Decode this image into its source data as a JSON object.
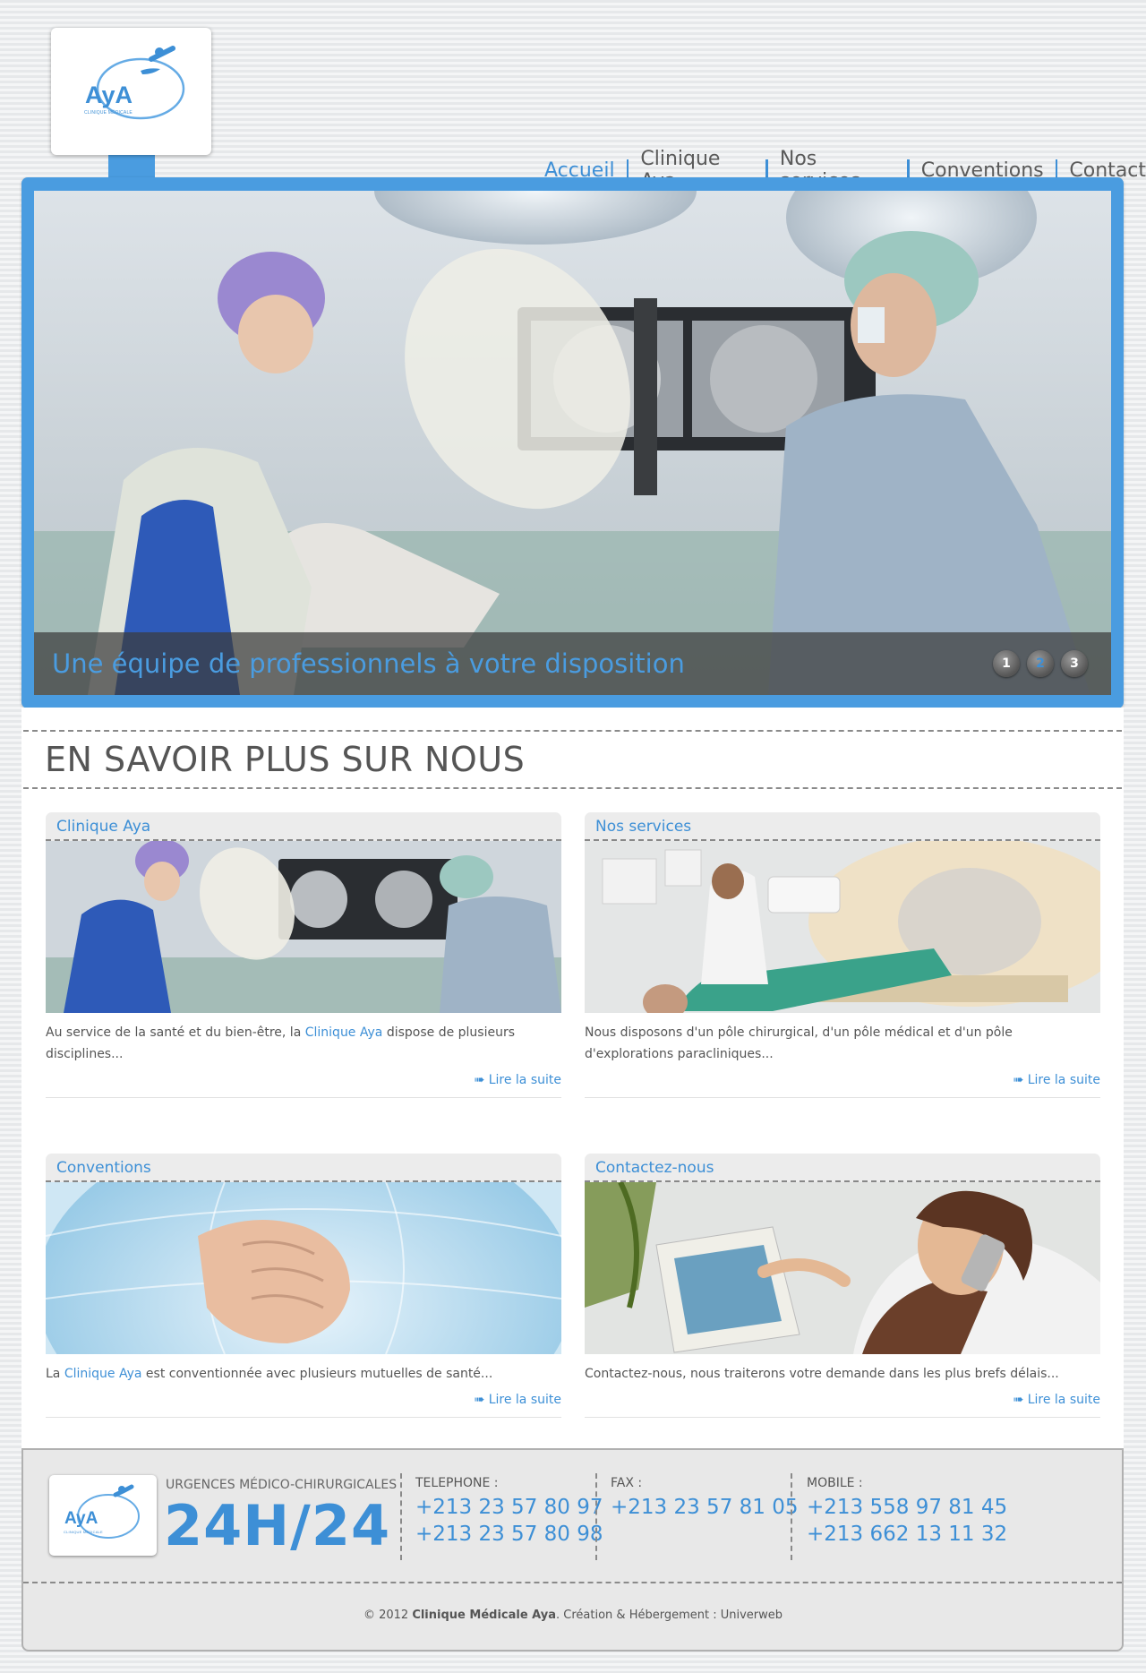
{
  "brand": {
    "logo_text": "AyA",
    "logo_subtext": "CLINIQUE MÉDICALE"
  },
  "nav": {
    "items": [
      {
        "label": "Accueil",
        "active": true
      },
      {
        "label": "Clinique Aya"
      },
      {
        "label": "Nos services"
      },
      {
        "label": "Conventions"
      },
      {
        "label": "Contact"
      }
    ]
  },
  "hero": {
    "caption": "Une équipe de professionnels à votre disposition",
    "dots": [
      "1",
      "2",
      "3"
    ],
    "active_dot": 2
  },
  "section": {
    "title": "EN SAVOIR PLUS SUR NOUS"
  },
  "cards": [
    {
      "title": "Clinique Aya",
      "text_before": "Au service de la santé et du bien-être, la ",
      "text_highlight": "Clinique Aya",
      "text_after": " dispose de plusieurs disciplines...",
      "more": "➠ Lire la suite"
    },
    {
      "title": "Nos services",
      "text_before": "Nous disposons d'un pôle chirurgical, d'un pôle médical et d'un pôle d'explorations paracliniques...",
      "text_highlight": "",
      "text_after": "",
      "more": "➠ Lire la suite"
    },
    {
      "title": "Conventions",
      "text_before": "La ",
      "text_highlight": "Clinique Aya",
      "text_after": " est conventionnée avec plusieurs mutuelles de santé...",
      "more": "➠ Lire la suite"
    },
    {
      "title": "Contactez-nous",
      "text_before": "Contactez-nous, nous traiterons votre demande dans les plus brefs délais...",
      "text_highlight": "",
      "text_after": "",
      "more": "➠ Lire la suite"
    }
  ],
  "footer": {
    "urgences": "URGENCES MÉDICO-CHIRURGICALES",
    "hours": "24H/24",
    "telephone": {
      "label": "TELEPHONE :",
      "numbers": [
        "+213 23 57 80 97",
        "+213 23 57 80 98"
      ]
    },
    "fax": {
      "label": "FAX :",
      "numbers": [
        "+213 23 57 81 05"
      ]
    },
    "mobile": {
      "label": "MOBILE :",
      "numbers": [
        "+213 558 97 81 45",
        "+213 662 13 11 32"
      ]
    },
    "copyright_prefix": "© 2012 ",
    "copyright_name": "Clinique Médicale Aya",
    "copyright_suffix": ". Création & Hébergement : Univerweb"
  },
  "colors": {
    "accent": "#4a9ce0",
    "link": "#3d8fd6",
    "text": "#555555"
  }
}
